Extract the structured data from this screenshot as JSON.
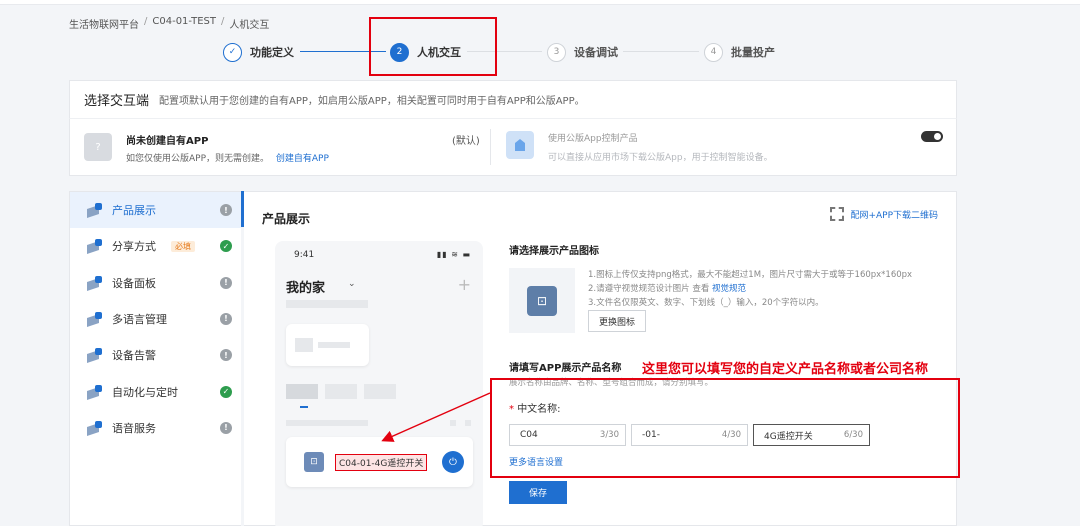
{
  "breadcrumb": {
    "root": "生活物联网平台",
    "sep": "/",
    "project": "C04-01-TEST",
    "current": "人机交互"
  },
  "steps": [
    {
      "num": "✓",
      "label": "功能定义",
      "state": "done"
    },
    {
      "num": "2",
      "label": "人机交互",
      "state": "active"
    },
    {
      "num": "3",
      "label": "设备调试",
      "state": "todo"
    },
    {
      "num": "4",
      "label": "批量投产",
      "state": "todo"
    }
  ],
  "select_panel": {
    "title": "选择交互端",
    "desc": "配置项默认用于您创建的自有APP，如启用公版APP，相关配置可同时用于自有APP和公版APP。",
    "own_app": {
      "icon": "?",
      "title": "尚未创建自有APP",
      "default_tag": "(默认)",
      "desc": "如您仅使用公版APP，则无需创建。",
      "link": "创建自有APP"
    },
    "public_app": {
      "title": "使用公版App控制产品",
      "desc": "可以直接从应用市场下载公版App，用于控制智能设备。",
      "enabled": false
    }
  },
  "sidebar": {
    "items": [
      {
        "label": "产品展示",
        "status": "warn",
        "active": true
      },
      {
        "label": "分享方式",
        "status": "ok",
        "tag": "必填"
      },
      {
        "label": "设备面板",
        "status": "warn"
      },
      {
        "label": "多语言管理",
        "status": "warn"
      },
      {
        "label": "设备告警",
        "status": "warn"
      },
      {
        "label": "自动化与定时",
        "status": "ok"
      },
      {
        "label": "语音服务",
        "status": "warn"
      }
    ],
    "status_icons": {
      "warn": "!",
      "ok": "✓"
    }
  },
  "main": {
    "title": "产品展示",
    "qr_link": "配网+APP下载二维码",
    "phone": {
      "time": "9:41",
      "status_icons": "▮▮ ≋ ▬",
      "home": "我的家",
      "chevron": "⌄",
      "plus": "+",
      "device_name": "C04-01-4G遥控开关",
      "device_icon": "⊡",
      "power_icon": "⏻"
    },
    "icon_section": {
      "title": "请选择展示产品图标",
      "icon_glyph": "⊡",
      "tip1": "1.图标上传仅支持png格式，最大不能超过1M，图片尺寸需大于或等于160px*160px",
      "tip2_prefix": "2.请遵守视觉规范设计图片 查看 ",
      "tip2_link": "视觉规范",
      "tip3": "3.文件名仅限英文、数字、下划线（_）输入，20个字符以内。",
      "change_button": "更换图标"
    },
    "name_section": {
      "title": "请填写APP展示产品名称",
      "hint": "展示名称由品牌、名称、型号组合而成，请分别填写。",
      "label": "中文名称:",
      "required_mark": "*",
      "fields": [
        {
          "value": "C04",
          "count": "3/30"
        },
        {
          "value": "-01-",
          "count": "4/30"
        },
        {
          "value": "4G遥控开关",
          "count": "6/30"
        }
      ],
      "more_lang": "更多语言设置",
      "save_button": "保存"
    },
    "annotation": "这里您可以填写您的自定义产品名称或者公司名称"
  },
  "colors": {
    "primary": "#1f6fd0",
    "annotation_red": "#e3000f",
    "ok_green": "#2e9d4e"
  }
}
